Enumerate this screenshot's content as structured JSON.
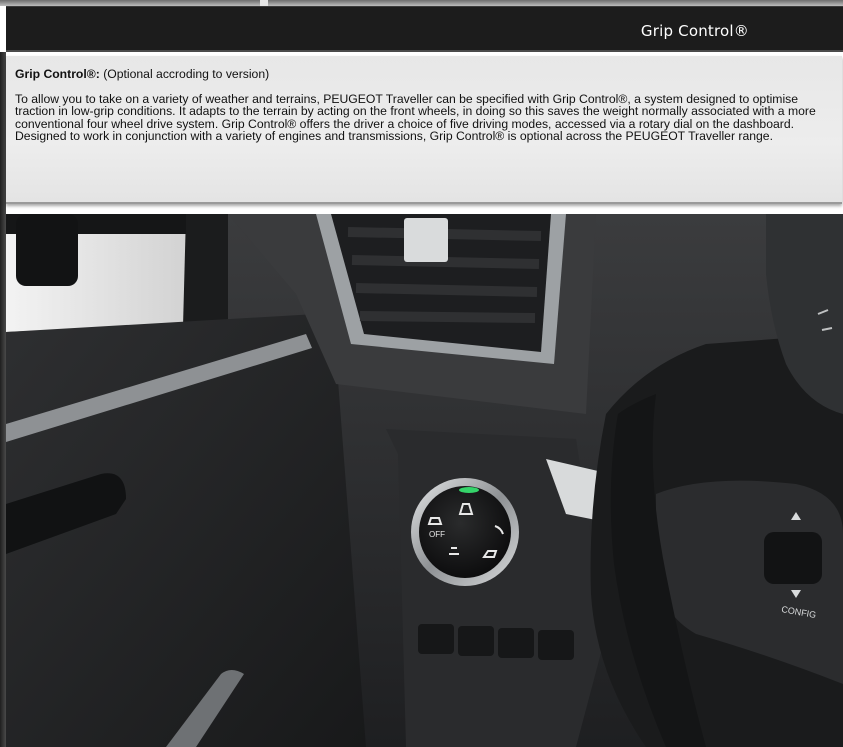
{
  "header": {
    "title": "Grip Control®"
  },
  "info": {
    "heading_bold": "Grip Control®:",
    "heading_rest": " (Optional accroding to version)",
    "body": "To allow you to take on a variety of weather and terrains, PEUGEOT Traveller can be specified with Grip Control®, a system designed to optimise traction in low-grip conditions. It adapts to the terrain by acting on the front wheels, in doing so this saves the weight normally associated with a more conventional four wheel drive system.  Grip Control® offers the driver a choice of five driving modes, accessed via a rotary dial on the dashboard. Designed to work in conjunction with a variety of  engines and transmissions, Grip Control® is optional across the PEUGEOT Traveller range."
  },
  "photo": {
    "dial_off_label": "OFF",
    "stalk_label": "CONFIG",
    "colors": {
      "dial_indicator": "#35d46a",
      "dash": "#2c2d2f",
      "vent_trim": "#9da1a4"
    }
  }
}
